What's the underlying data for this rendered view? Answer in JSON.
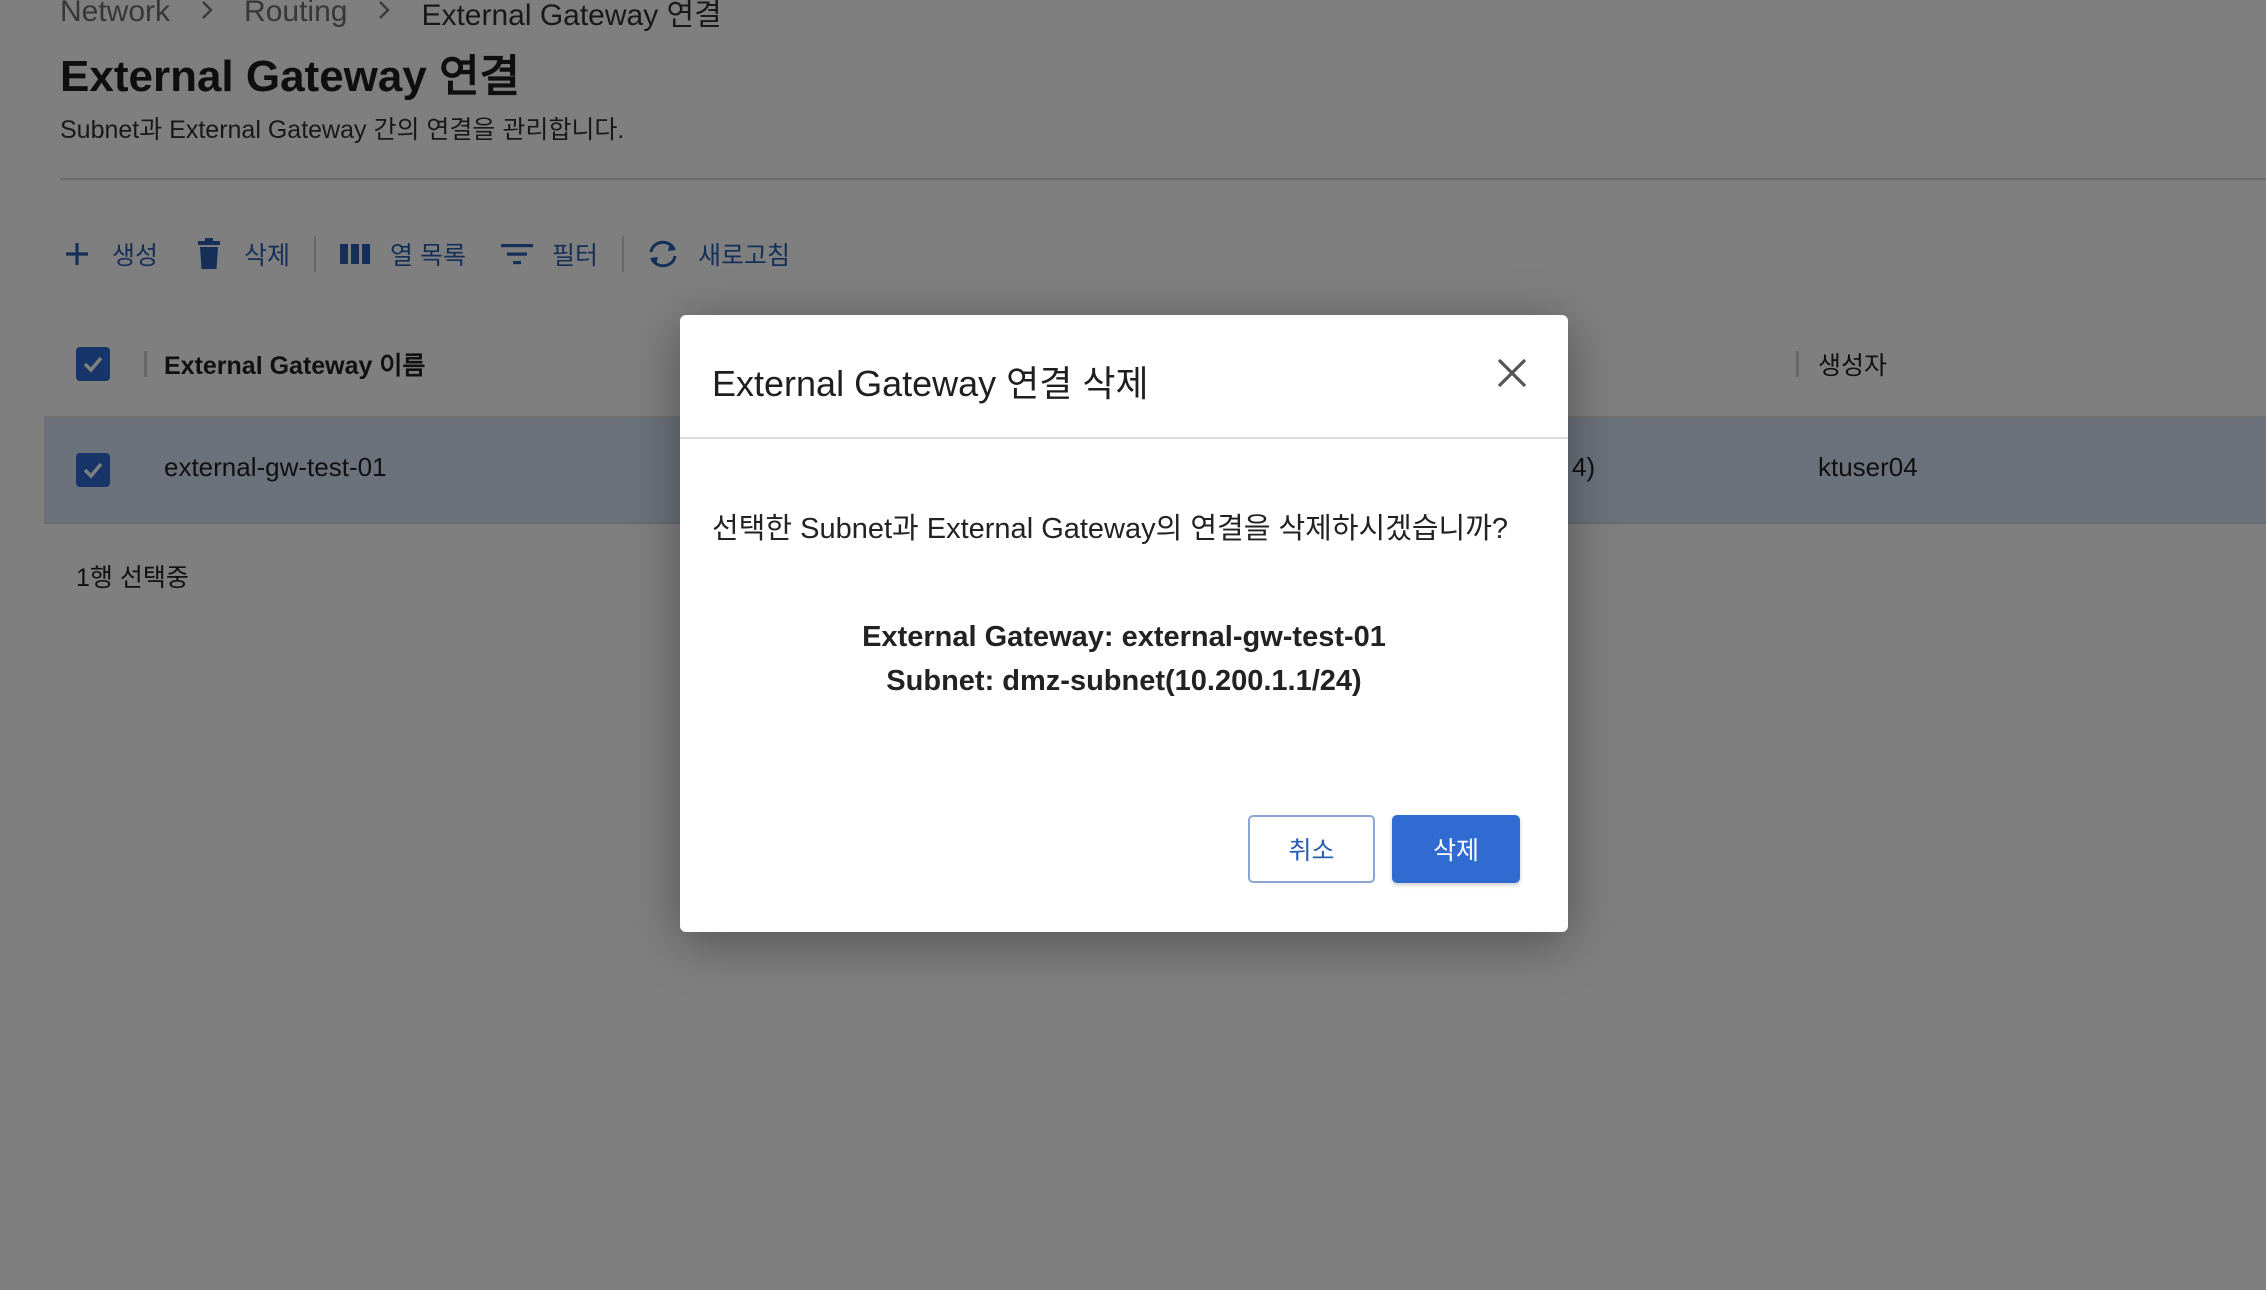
{
  "breadcrumb": {
    "items": [
      "Network",
      "Routing",
      "External Gateway 연결"
    ],
    "separator": ">"
  },
  "page": {
    "title": "External Gateway 연결",
    "description": "Subnet과 External Gateway 간의 연결을 관리합니다."
  },
  "toolbar": {
    "create_label": "생성",
    "delete_label": "삭제",
    "columns_label": "열 목록",
    "filter_label": "필터",
    "refresh_label": "새로고침"
  },
  "table": {
    "columns": [
      "External Gateway 이름",
      "생성자"
    ],
    "rows": [
      {
        "name": "external-gw-test-01",
        "partial": "4)",
        "creator": "ktuser04",
        "selected": true
      }
    ],
    "selected_count_text": "1행 선택중"
  },
  "modal": {
    "title": "External Gateway 연결 삭제",
    "message": "선택한 Subnet과 External Gateway의 연결을 삭제하시겠습니까?",
    "detail_gateway": "External Gateway: external-gw-test-01",
    "detail_subnet": "Subnet: dmz-subnet(10.200.1.1/24)",
    "cancel_label": "취소",
    "confirm_label": "삭제"
  },
  "colors": {
    "accent": "#2f6bd0",
    "link": "#2a5fb0",
    "selected_row": "#d6e4f6",
    "overlay": "rgba(0,0,0,0.5)"
  },
  "icons": [
    "plus-icon",
    "trash-icon",
    "columns-icon",
    "filter-icon",
    "refresh-icon",
    "checkbox-checked-icon",
    "close-icon",
    "chevron-right-icon"
  ]
}
